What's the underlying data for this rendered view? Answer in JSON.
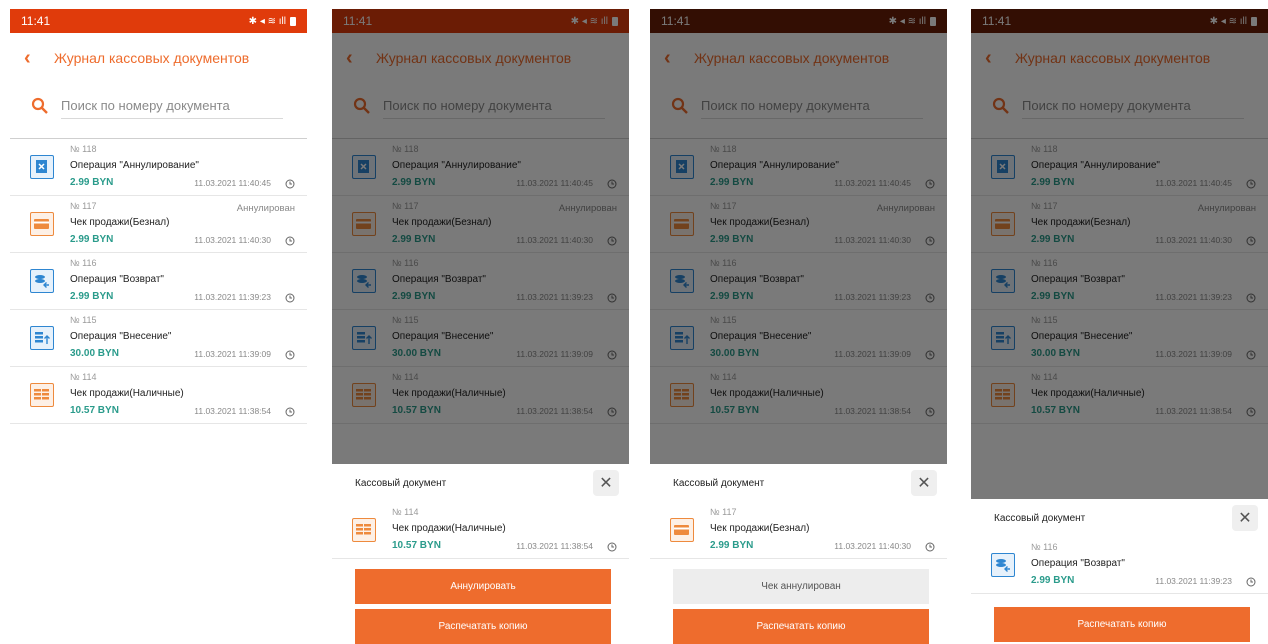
{
  "colors": {
    "accent": "#ee6c2d",
    "amount": "#2a9b8b",
    "statusbar": "#e03b0b",
    "statusbar_dim": "#6b1f07"
  },
  "status": {
    "time": "11:41",
    "icons": "✱ ◂ ≋ ıll"
  },
  "header": {
    "title": "Журнал кассовых документов",
    "back_icon": "chevron-left-icon"
  },
  "search": {
    "placeholder": "Поиск по номеру документа",
    "icon": "search-icon"
  },
  "documents": [
    {
      "number": "№ 118",
      "operation": "Операция \"Аннулирование\"",
      "amount": "2.99 BYN",
      "datetime": "11.03.2021 11:40:45",
      "status": "",
      "icon": "cancel-document-icon"
    },
    {
      "number": "№ 117",
      "operation": "Чек продажи(Безнал)",
      "amount": "2.99 BYN",
      "datetime": "11.03.2021 11:40:30",
      "status": "Аннулирован",
      "icon": "card-icon"
    },
    {
      "number": "№ 116",
      "operation": "Операция \"Возврат\"",
      "amount": "2.99 BYN",
      "datetime": "11.03.2021 11:39:23",
      "status": "",
      "icon": "return-icon"
    },
    {
      "number": "№ 115",
      "operation": "Операция \"Внесение\"",
      "amount": "30.00 BYN",
      "datetime": "11.03.2021 11:39:09",
      "status": "",
      "icon": "deposit-icon"
    },
    {
      "number": "№ 114",
      "operation": "Чек продажи(Наличные)",
      "amount": "10.57 BYN",
      "datetime": "11.03.2021 11:38:54",
      "status": "",
      "icon": "cash-icon"
    }
  ],
  "sheet": {
    "title": "Кассовый документ",
    "annul_label": "Аннулировать",
    "print_copy_label": "Распечатать копию",
    "annulled_label": "Чек аннулирован"
  }
}
